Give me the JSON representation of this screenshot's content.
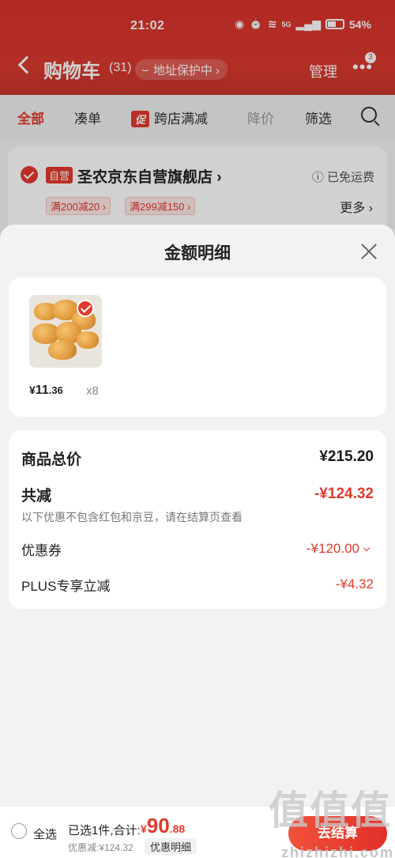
{
  "status_bar": {
    "time": "21:02",
    "net": "5G",
    "battery": "54%"
  },
  "header": {
    "title": "购物车",
    "count": "(31)",
    "address_badge": "地址保护中 ›",
    "manage": "管理",
    "more_badge": "3"
  },
  "tabs": {
    "all": "全部",
    "bundle": "凑单",
    "promo_chip": "促",
    "cross_store": "跨店满减",
    "price_drop": "降价",
    "filter": "筛选"
  },
  "store": {
    "self_tag": "自营",
    "name": "圣农京东自营旗舰店 ›",
    "free_shipping": "ⓘ 已免运费",
    "coupons": [
      "满200减20 ›",
      "满299减150 ›"
    ],
    "more": "更多 ›"
  },
  "sheet": {
    "title": "金额明细",
    "product": {
      "price_yen": "¥",
      "price_int": "11",
      "price_dec": ".36",
      "qty": "x8"
    },
    "summary": {
      "total_label": "商品总价",
      "total_value": "¥215.20",
      "reduce_label": "共减",
      "reduce_value": "-¥124.32",
      "note": "以下优惠不包含红包和京豆，请在结算页查看",
      "coupon_label": "优惠券",
      "coupon_value": "-¥120.00",
      "plus_label": "PLUS专享立减",
      "plus_value": "-¥4.32"
    }
  },
  "bottom": {
    "select_all": "全选",
    "selected_text": "已选1件,合计:",
    "total_yen": "¥",
    "total_int": "90",
    "total_dec": ".88",
    "discount_text": "优惠减:¥124.32",
    "detail_label": "优惠明细",
    "checkout": "去结算",
    "watermark": "值值值",
    "watermark_sub": "zhizhizhi.com"
  },
  "colors": {
    "brand_red": "#e23a2e",
    "header_red": "#d9322b"
  }
}
